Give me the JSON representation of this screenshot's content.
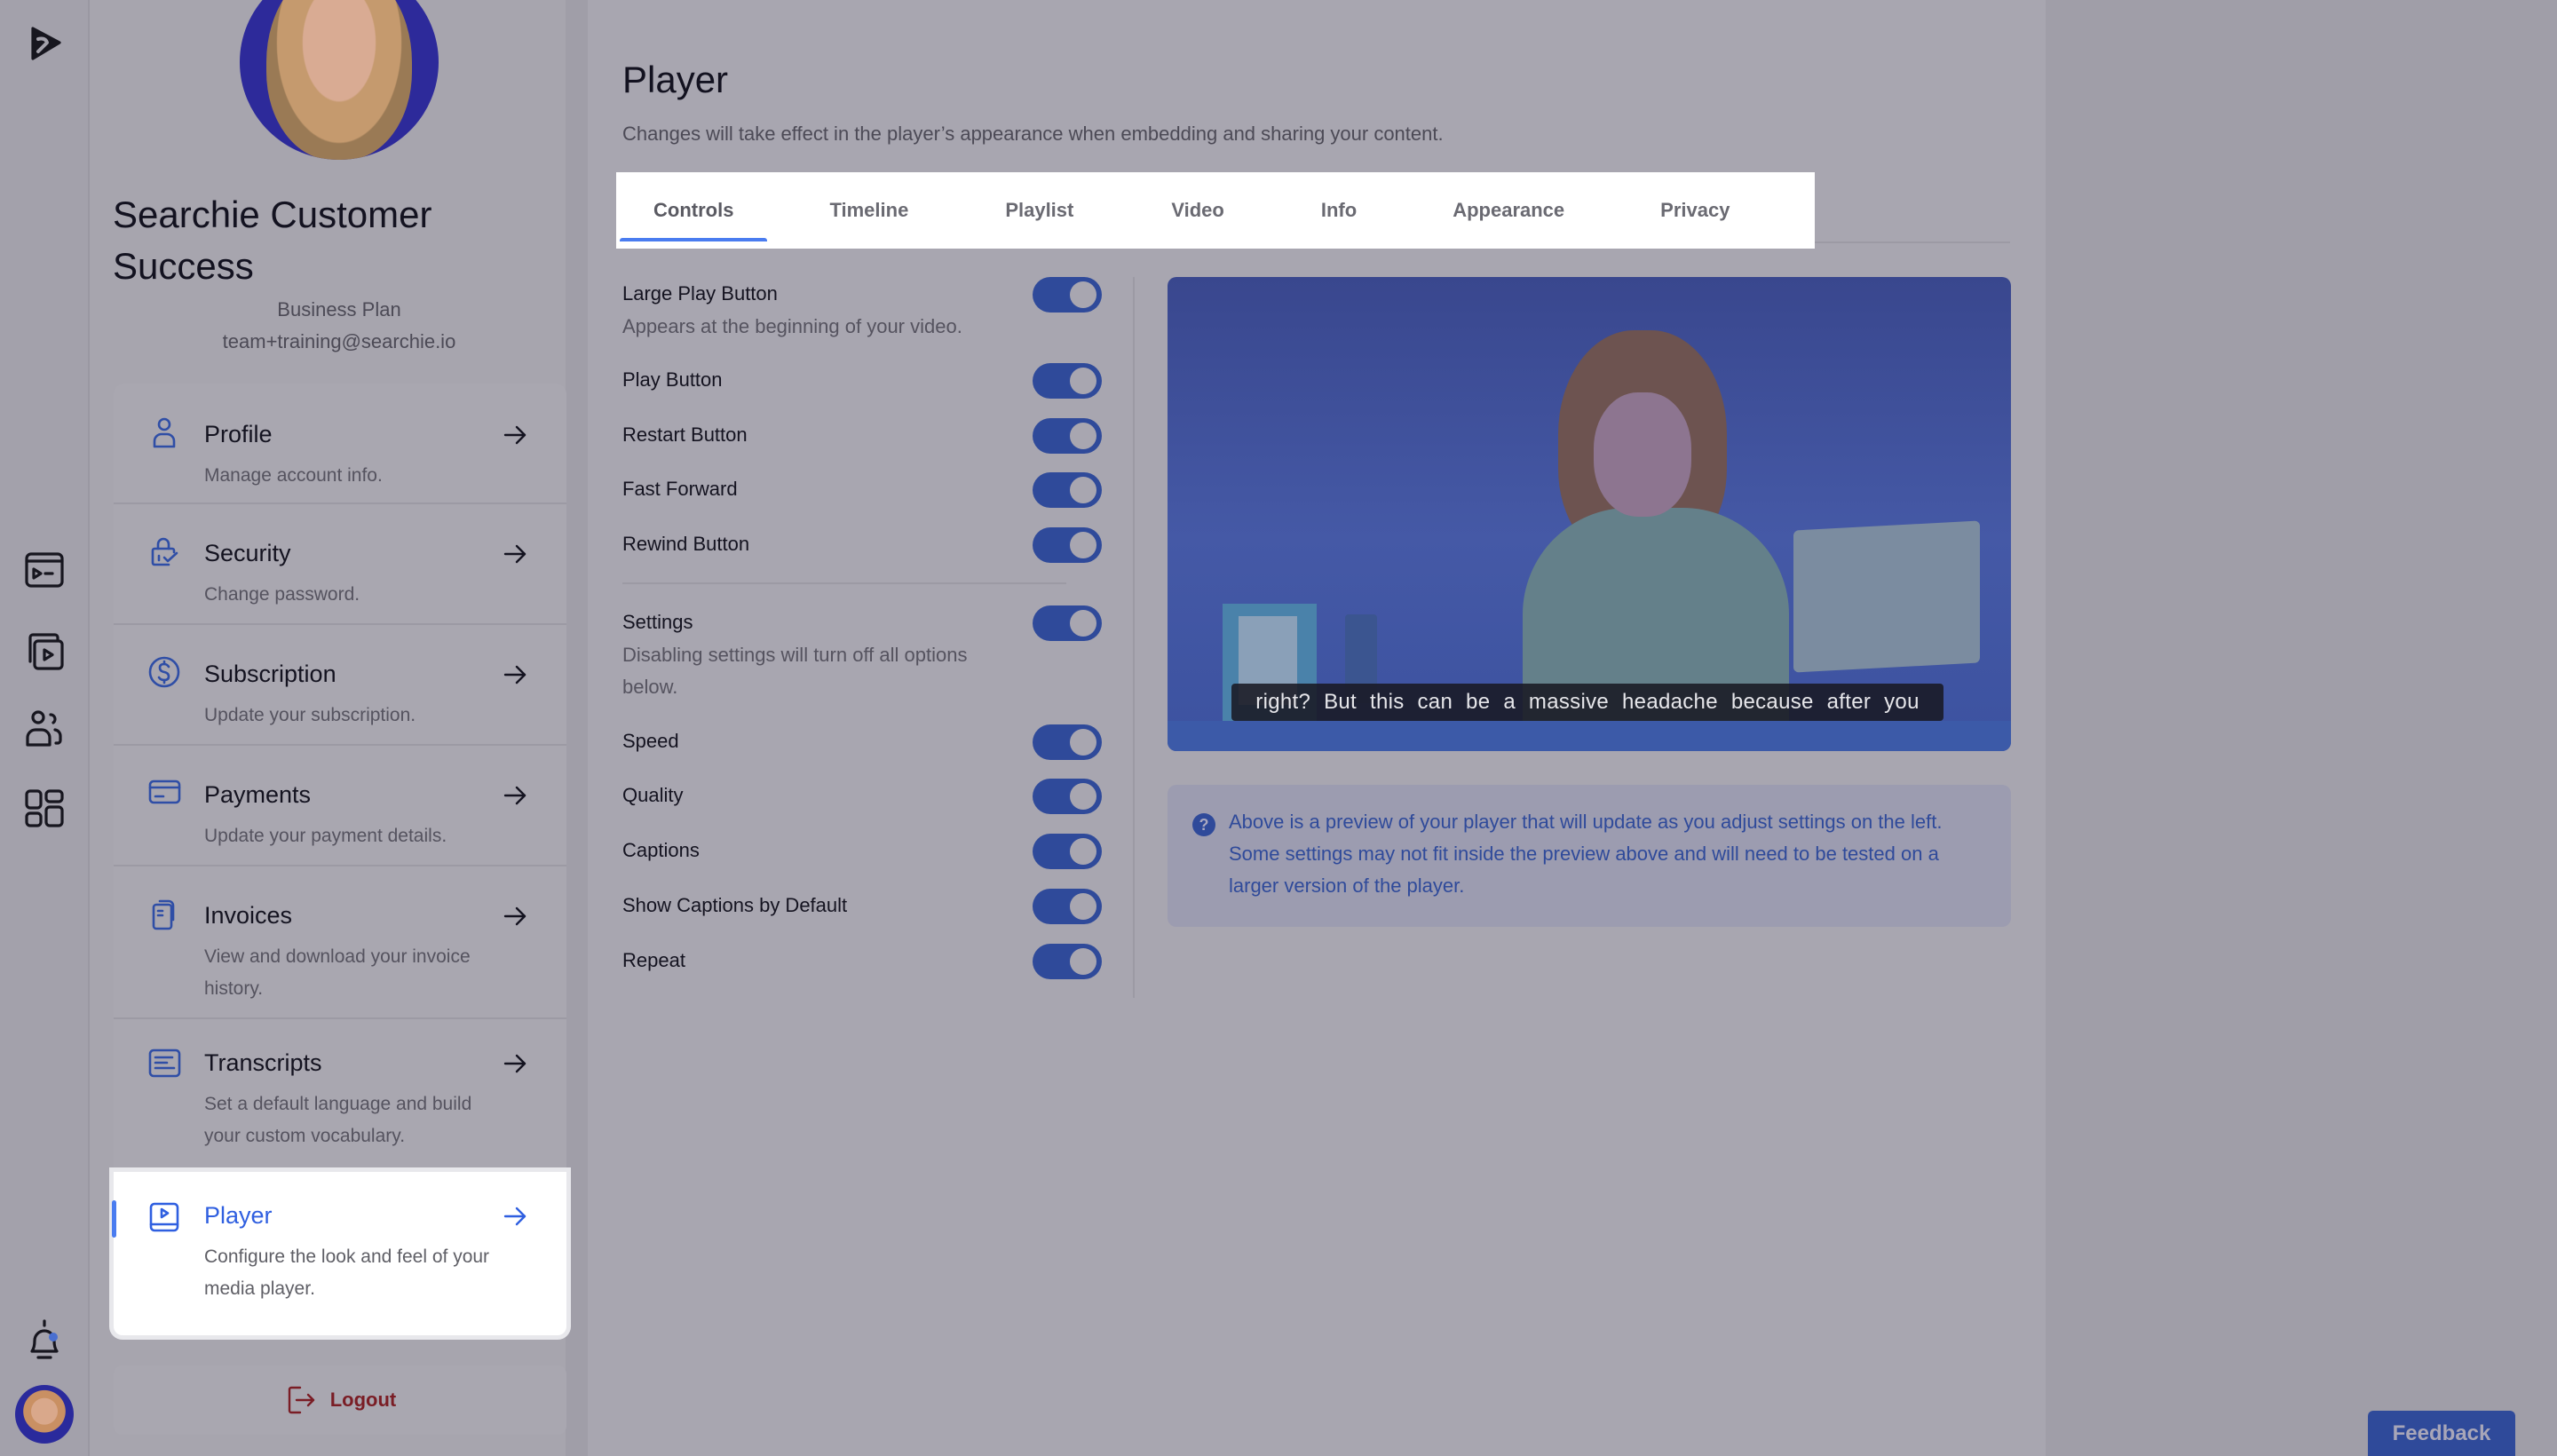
{
  "rail": {
    "icons": [
      "logo-icon",
      "media-library-icon",
      "collections-icon",
      "audience-icon",
      "apps-grid-icon",
      "notification-bell-icon"
    ],
    "notification_dot_color": "#4a6fd0"
  },
  "profile": {
    "name": "Searchie Customer Success",
    "plan": "Business Plan",
    "email": "team+training@searchie.io"
  },
  "menu": {
    "items": [
      {
        "id": "profile",
        "title": "Profile",
        "desc": "Manage account info.",
        "icon": "user-icon",
        "active": false
      },
      {
        "id": "security",
        "title": "Security",
        "desc": "Change password.",
        "icon": "lock-check-icon",
        "active": false
      },
      {
        "id": "subscription",
        "title": "Subscription",
        "desc": "Update your subscription.",
        "icon": "dollar-circle-icon",
        "active": false
      },
      {
        "id": "payments",
        "title": "Payments",
        "desc": "Update your payment details.",
        "icon": "credit-card-icon",
        "active": false
      },
      {
        "id": "invoices",
        "title": "Invoices",
        "desc": "View and download your invoice history.",
        "icon": "documents-icon",
        "active": false
      },
      {
        "id": "transcripts",
        "title": "Transcripts",
        "desc": "Set a default language and build your custom vocabulary.",
        "icon": "text-lines-icon",
        "active": false
      },
      {
        "id": "player",
        "title": "Player",
        "desc": "Configure the look and feel of your media player.",
        "icon": "player-icon",
        "active": true
      }
    ],
    "logout_label": "Logout"
  },
  "page": {
    "title": "Player",
    "subtitle": "Changes will take effect in the player’s appearance when embedding and sharing your content."
  },
  "tabs": [
    {
      "label": "Controls",
      "active": true
    },
    {
      "label": "Timeline",
      "active": false
    },
    {
      "label": "Playlist",
      "active": false
    },
    {
      "label": "Video",
      "active": false
    },
    {
      "label": "Info",
      "active": false
    },
    {
      "label": "Appearance",
      "active": false
    },
    {
      "label": "Privacy",
      "active": false
    }
  ],
  "controls": [
    {
      "label": "Large Play Button",
      "desc": "Appears at the beginning of your video.",
      "on": true
    },
    {
      "label": "Play Button",
      "desc": "",
      "on": true
    },
    {
      "label": "Restart Button",
      "desc": "",
      "on": true
    },
    {
      "label": "Fast Forward",
      "desc": "",
      "on": true
    },
    {
      "label": "Rewind Button",
      "desc": "",
      "on": true
    },
    {
      "label": "Settings",
      "desc": "Disabling settings will turn off all options below.",
      "on": true
    },
    {
      "label": "Speed",
      "desc": "",
      "on": true
    },
    {
      "label": "Quality",
      "desc": "",
      "on": true
    },
    {
      "label": "Captions",
      "desc": "",
      "on": true
    },
    {
      "label": "Show Captions by Default",
      "desc": "",
      "on": true
    },
    {
      "label": "Repeat",
      "desc": "",
      "on": true
    }
  ],
  "preview": {
    "caption": "right? But this can be a massive headache because after you",
    "note": "Above is a preview of your player that will update as you adjust settings on the left. Some settings may not fit inside the preview above and will need to be tested on a larger version of the player.",
    "note_icon": "question-circle-icon"
  },
  "feedback_label": "Feedback",
  "colors": {
    "accent": "#2f5fe0",
    "toggle_on": "#2f4a9a",
    "logout": "#7a1d25"
  }
}
